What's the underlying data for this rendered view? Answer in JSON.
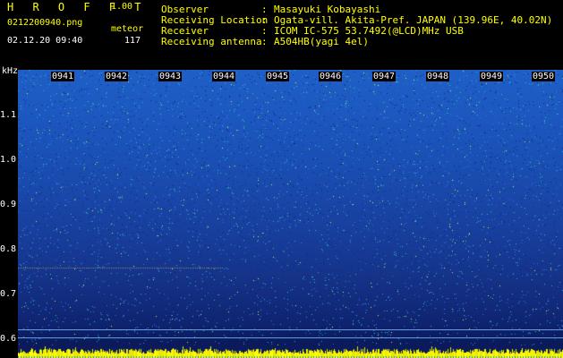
{
  "header": {
    "app_title": "H R O F F T",
    "version": "1.00",
    "file_name": "0212200940.png",
    "meteor_label": "meteor",
    "datetime": "02.12.20 09:40",
    "meteor_count": "117",
    "info": [
      {
        "key": "Observer",
        "value": "Masayuki Kobayashi"
      },
      {
        "key": "Receiving Location",
        "value": "Ogata-vill. Akita-Pref. JAPAN (139.96E, 40.02N)"
      },
      {
        "key": "Receiver",
        "value": "ICOM IC-575 53.7492(@LCD)MHz USB"
      },
      {
        "key": "Receiving antenna",
        "value": "A504HB(yagi 4el)"
      }
    ],
    "colon": ":"
  },
  "spectrogram": {
    "y_unit": "kHz",
    "y_ticks": [
      "1.1",
      "1.0",
      "0.9",
      "0.8",
      "0.7",
      "0.6"
    ],
    "x_ticks": [
      "0941",
      "0942",
      "0943",
      "0944",
      "0945",
      "0946",
      "0947",
      "0948",
      "0949",
      "0950"
    ],
    "colors": {
      "hot": "#ffff00",
      "warm": "#00e6a0",
      "cool": "#1e5fc6",
      "cold": "#0a1a5a"
    }
  }
}
